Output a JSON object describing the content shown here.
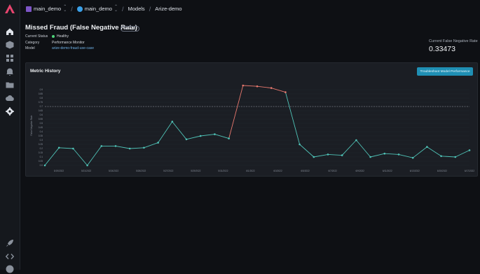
{
  "breadcrumb": {
    "space": "main_demo",
    "project": "main_demo",
    "section": "Models",
    "model": "Arize-demo"
  },
  "monitor": {
    "title": "Missed Fraud (False Negative Rate)",
    "badge": "Managed",
    "status_label": "Current Status",
    "status_value": "Healthy",
    "category_label": "Category",
    "category_value": "Performance Monitor",
    "model_label": "Model",
    "model_value": "arize-demo-fraud-use-case"
  },
  "current": {
    "label": "Current False Negative Rate",
    "value": "0.33473"
  },
  "panel": {
    "title": "Metric History",
    "button": "Troubleshoot Model Performance"
  },
  "colors": {
    "line_normal": "#4fc3b7",
    "line_alert": "#e8786e",
    "threshold": "#9aa0a8",
    "accent": "#1f8fb4"
  },
  "chart_data": {
    "type": "line",
    "ylabel": "False Negative Rate",
    "ylim": [
      0,
      0.95
    ],
    "threshold": 0.7,
    "yticks": [
      "0.0",
      "0.05",
      "0.1",
      "0.15",
      "0.2",
      "0.25",
      "0.3",
      "0.35",
      "0.4",
      "0.45",
      "0.5",
      "0.55",
      "0.6",
      "0.65",
      "0.7",
      "0.75",
      "0.8",
      "0.85",
      "0.9"
    ],
    "xticks": [
      "5/19/2022",
      "5/21/2022",
      "5/24/2022",
      "5/26/2022",
      "5/27/2022",
      "5/29/2022",
      "5/31/2022",
      "6/1/2022",
      "6/3/2022",
      "6/5/2022",
      "6/7/2022",
      "6/9/2022",
      "6/11/2022",
      "6/13/2022",
      "6/15/2022",
      "6/17/2022"
    ],
    "series": [
      {
        "values": [
          0.0,
          0.21,
          0.2,
          0.0,
          0.23,
          0.23,
          0.2,
          0.21,
          0.27,
          0.52,
          0.31,
          0.35,
          0.37,
          0.32,
          0.95,
          0.94,
          0.92,
          0.87,
          0.25,
          0.1,
          0.13,
          0.12,
          0.3,
          0.1,
          0.14,
          0.13,
          0.09,
          0.22,
          0.11,
          0.1,
          0.18
        ],
        "alert_from": 14,
        "alert_to": 17
      }
    ]
  }
}
